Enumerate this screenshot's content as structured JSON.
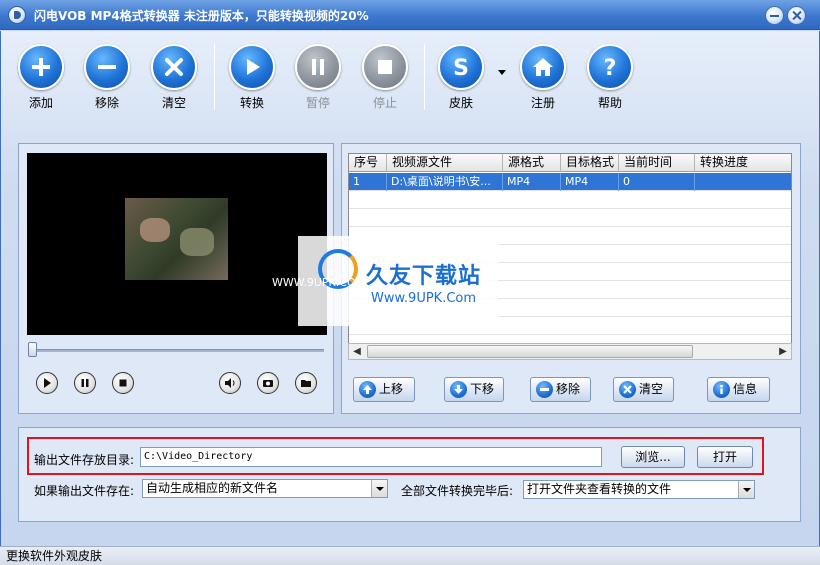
{
  "window": {
    "title": "闪电VOB MP4格式转换器   未注册版本，只能转换视频的20%"
  },
  "toolbar": {
    "add": "添加",
    "remove": "移除",
    "clear": "清空",
    "convert": "转换",
    "pause": "暂停",
    "stop": "停止",
    "skin": "皮肤",
    "register": "注册",
    "help": "帮助"
  },
  "file_table": {
    "columns": [
      "序号",
      "视频源文件",
      "源格式",
      "目标格式",
      "当前时间",
      "转换进度"
    ],
    "rows": [
      {
        "index": "1",
        "source": "D:\\桌面\\说明书\\安...",
        "src_format": "MP4",
        "dst_format": "MP4",
        "current_time": "0",
        "progress": ""
      }
    ]
  },
  "list_actions": {
    "move_up": "上移",
    "move_down": "下移",
    "remove": "移除",
    "clear": "清空",
    "info": "信息"
  },
  "settings": {
    "output_dir_label": "输出文件存放目录:",
    "output_dir_value": "C:\\Video_Directory",
    "browse": "浏览...",
    "open": "打开",
    "exists_label": "如果输出文件存在:",
    "exists_value": "自动生成相应的新文件名",
    "after_label": "全部文件转换完毕后:",
    "after_value": "打开文件夹查看转换的文件"
  },
  "status": {
    "text": "更换软件外观皮肤"
  },
  "watermark": {
    "title": "久友下载站",
    "url": "Www.9UPK.Com",
    "side": "WWW.9UPK.COM"
  },
  "colors": {
    "accent": "#2f75d6",
    "highlight_border": "#e0131b"
  }
}
